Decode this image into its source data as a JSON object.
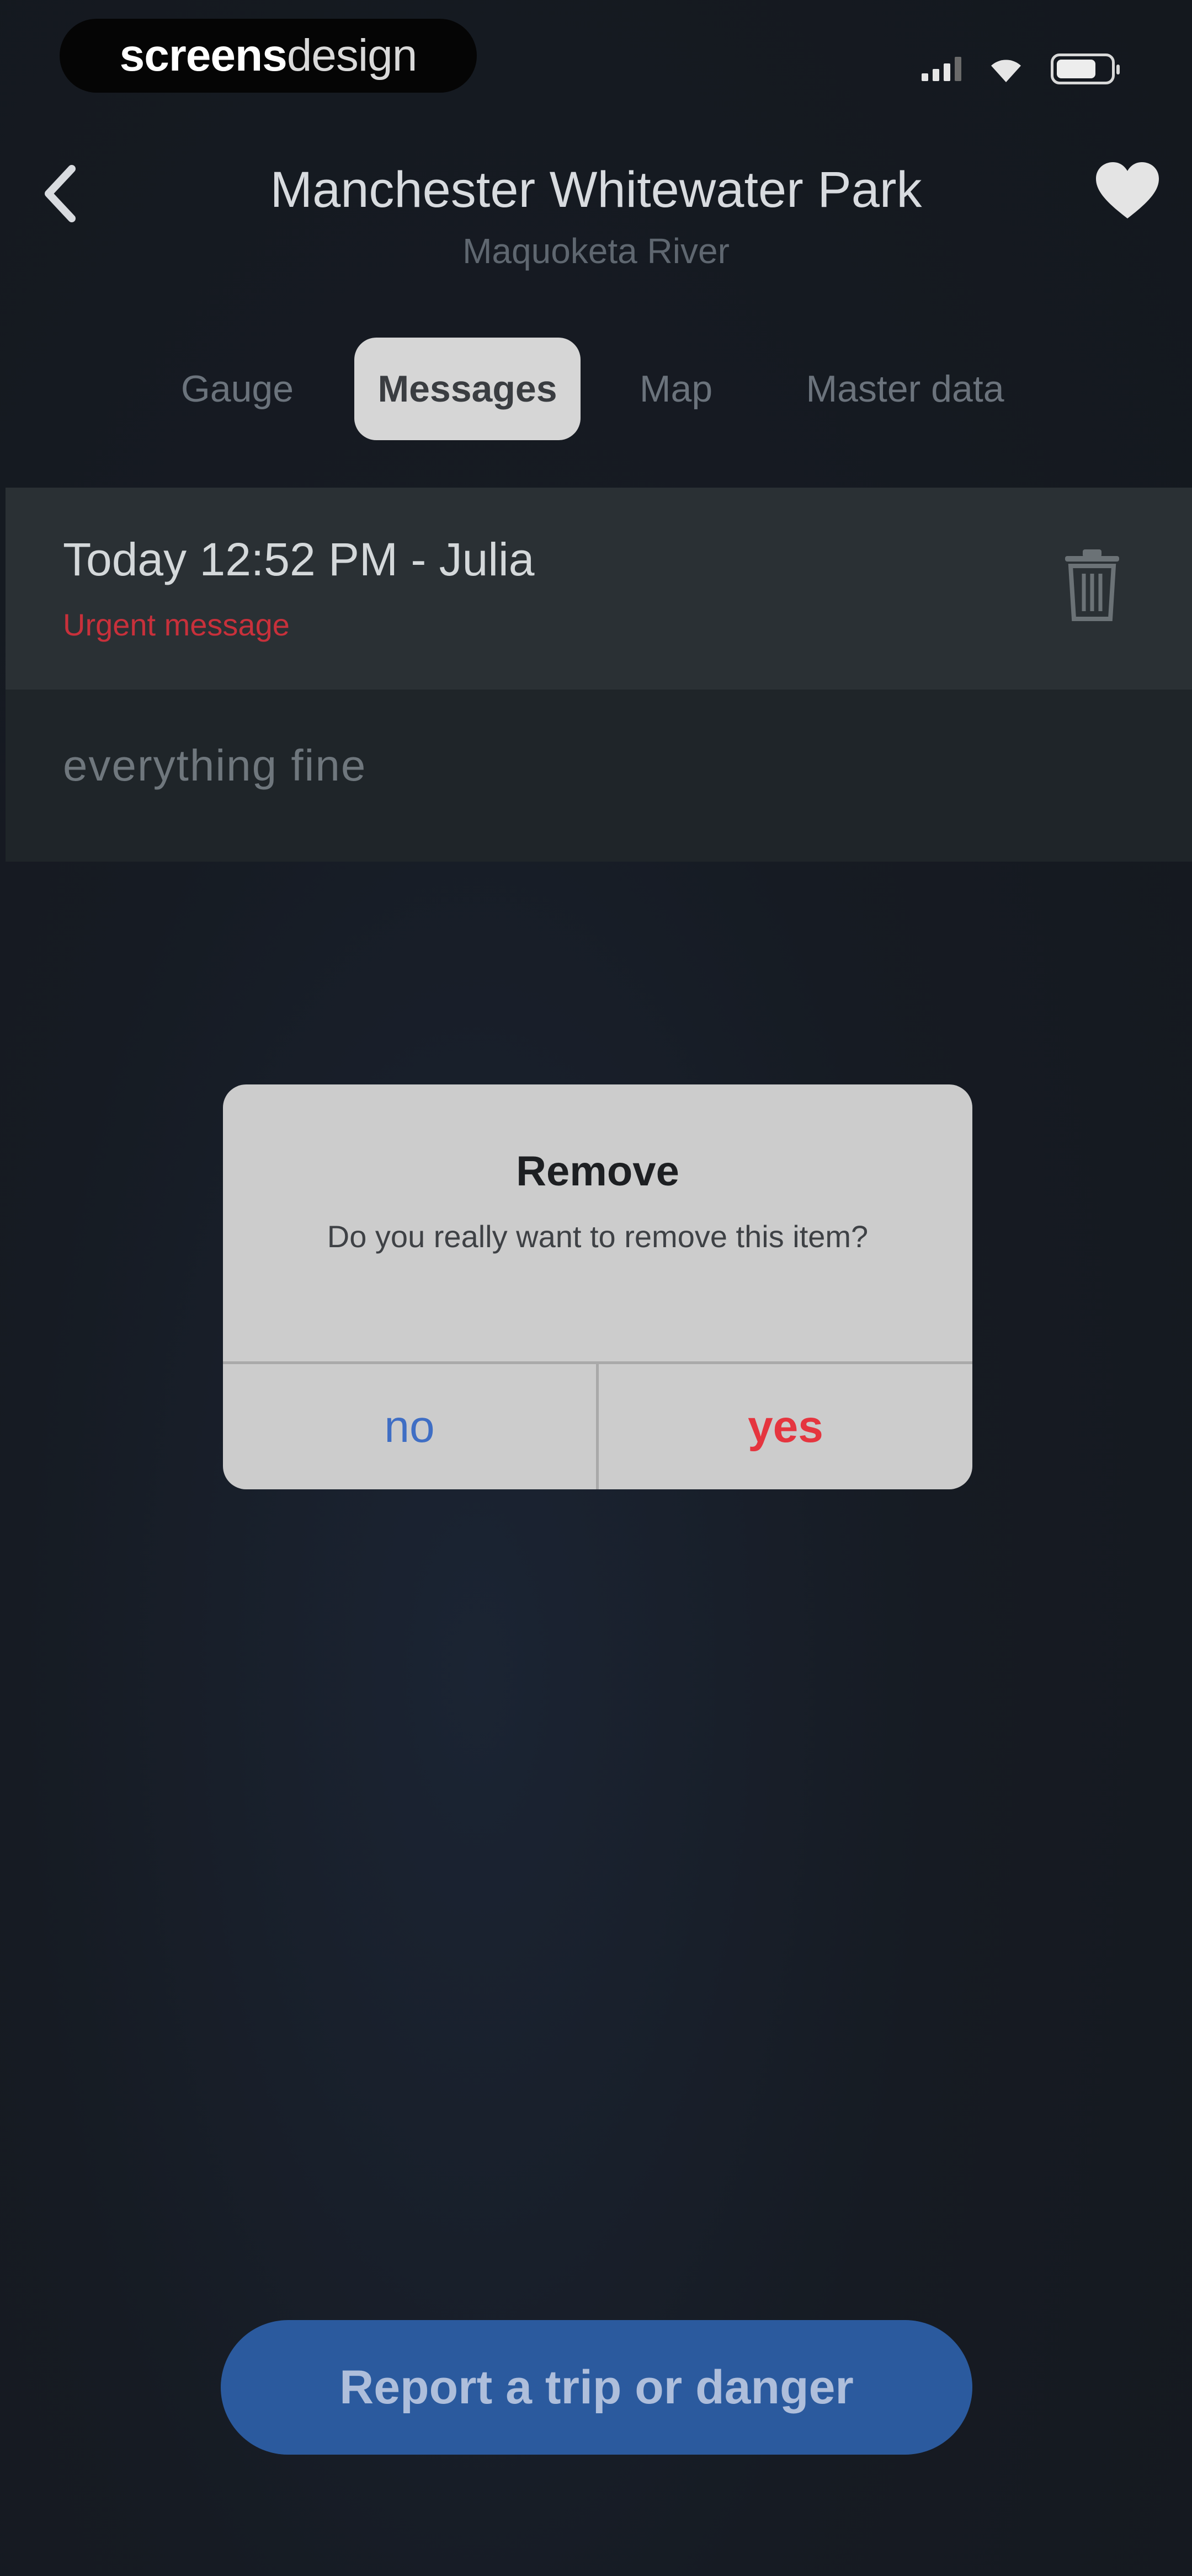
{
  "status_bar": {
    "brand_part1": "screens",
    "brand_part2": "design",
    "icons": [
      "signal-icon",
      "wifi-icon",
      "battery-icon"
    ]
  },
  "header": {
    "title": "Manchester Whitewater Park",
    "subtitle": "Maquoketa River",
    "back_icon": "chevron-left-icon",
    "favorite_icon": "heart-icon"
  },
  "tabs": [
    {
      "label": "Gauge",
      "active": false
    },
    {
      "label": "Messages",
      "active": true
    },
    {
      "label": "Map",
      "active": false
    },
    {
      "label": "Master data",
      "active": false
    }
  ],
  "message": {
    "time_author": "Today 12:52 PM - Julia",
    "tag": "Urgent message",
    "body": "everything fine",
    "delete_icon": "trash-icon"
  },
  "dialog": {
    "title": "Remove",
    "message": "Do you really want to remove this item?",
    "no_label": "no",
    "yes_label": "yes"
  },
  "report_button": {
    "label": "Report a trip or danger"
  },
  "colors": {
    "background": "#161a20",
    "accent_blue": "#2b5a9e",
    "urgent_red": "#c8303b",
    "dialog_bg": "#cccccc",
    "no_blue": "#3f6ec4",
    "yes_red": "#e5353f"
  }
}
